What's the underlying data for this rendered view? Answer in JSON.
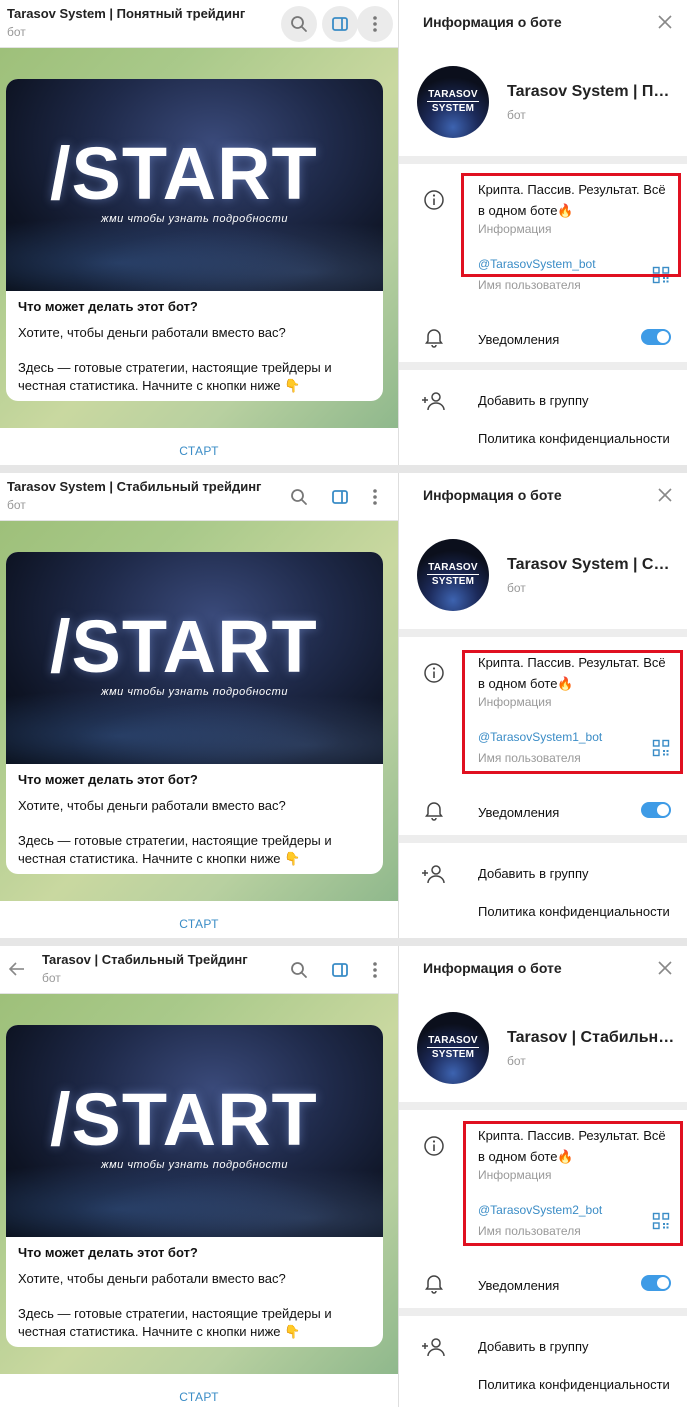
{
  "panels": [
    {
      "chat_title": "Tarasov System | Понятный трейдинг",
      "chat_sub": "бот",
      "banner_big": "/START",
      "banner_small": "жми чтобы узнать подробности",
      "bubble_q": "Что может делать этот бот?",
      "bubble_t1": "Хотите, чтобы деньги работали вместо вас?",
      "bubble_t2": "Здесь — готовые стратегии, настоящие трейдеры и честная статистика. Начните с кнопки ниже 👇",
      "start": "СТАРТ",
      "info_title": "Информация о боте",
      "avatar_t1": "TARASOV",
      "avatar_t2": "SYSTEM",
      "bot_name": "Tarasov System | Понятный трейдинг",
      "bot_sub": "бот",
      "about": "Крипта. Пассив. Результат. Всё в одном боте🔥",
      "about_label": "Информация",
      "username": "@TarasovSystem_bot",
      "username_label": "Имя пользователя",
      "notif": "Уведомления",
      "addgroup": "Добавить в группу",
      "privacy": "Политика конфиденциальности"
    },
    {
      "chat_title": "Tarasov System | Стабильный трейдинг",
      "chat_sub": "бот",
      "banner_big": "/START",
      "banner_small": "жми чтобы узнать подробности",
      "bubble_q": "Что может делать этот бот?",
      "bubble_t1": "Хотите, чтобы деньги работали вместо вас?",
      "bubble_t2": "Здесь — готовые стратегии, настоящие трейдеры и честная статистика. Начните с кнопки ниже 👇",
      "start": "СТАРТ",
      "info_title": "Информация о боте",
      "avatar_t1": "TARASOV",
      "avatar_t2": "SYSTEM",
      "bot_name": "Tarasov System | Стабильный трейдинг",
      "bot_sub": "бот",
      "about": "Крипта. Пассив. Результат. Всё в одном боте🔥",
      "about_label": "Информация",
      "username": "@TarasovSystem1_bot",
      "username_label": "Имя пользователя",
      "notif": "Уведомления",
      "addgroup": "Добавить в группу",
      "privacy": "Политика конфиденциальности"
    },
    {
      "chat_title": "Tarasov | Стабильный Трейдинг",
      "chat_sub": "бот",
      "banner_big": "/START",
      "banner_small": "жми чтобы узнать подробности",
      "bubble_q": "Что может делать этот бот?",
      "bubble_t1": "Хотите, чтобы деньги работали вместо вас?",
      "bubble_t2": "Здесь — готовые стратегии, настоящие трейдеры и честная статистика. Начните с кнопки ниже 👇",
      "start": "СТАРТ",
      "info_title": "Информация о боте",
      "avatar_t1": "TARASOV",
      "avatar_t2": "SYSTEM",
      "bot_name": "Tarasov | Стабильный Трейдинг",
      "bot_sub": "бот",
      "about": "Крипта. Пассив. Результат. Всё в одном боте🔥",
      "about_label": "Информация",
      "username": "@TarasovSystem2_bot",
      "username_label": "Имя пользователя",
      "notif": "Уведомления",
      "addgroup": "Добавить в группу",
      "privacy": "Политика конфиденциальности"
    }
  ],
  "colors": {
    "accent": "#3a8cc6",
    "toggle_on": "#3e9be6",
    "highlight_box": "#e01020"
  }
}
